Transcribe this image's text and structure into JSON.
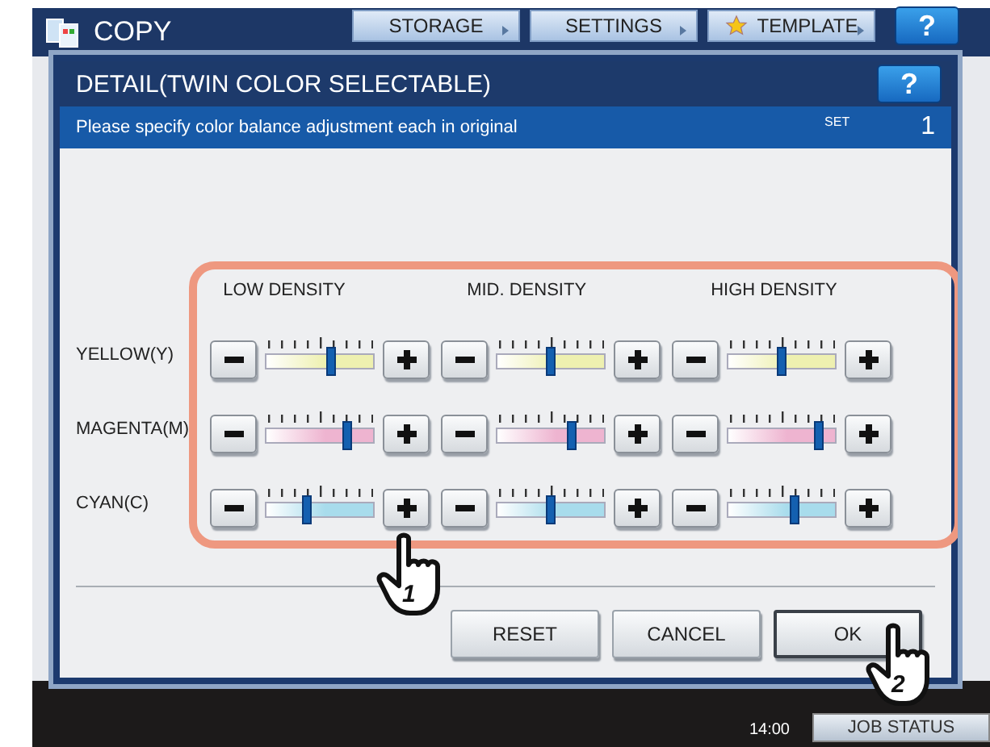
{
  "app": {
    "title": "COPY",
    "tabs": [
      {
        "label": "STORAGE",
        "kind": "plain"
      },
      {
        "label": "SETTINGS",
        "kind": "plain"
      },
      {
        "label": "TEMPLATE",
        "kind": "star"
      }
    ],
    "help": "?"
  },
  "dialog": {
    "title": "DETAIL(TWIN COLOR SELECTABLE)",
    "help": "?",
    "message": "Please specify color balance adjustment each in original",
    "set_label": "SET",
    "set_count": "1",
    "columns": [
      "LOW DENSITY",
      "MID. DENSITY",
      "HIGH DENSITY"
    ],
    "rows": [
      {
        "label": "YELLOW(Y)",
        "color": "#eef0b0",
        "sliders": [
          {
            "level": 0.6
          },
          {
            "level": 0.5
          },
          {
            "level": 0.5
          }
        ]
      },
      {
        "label": "MAGENTA(M)",
        "color": "#eeb4d0",
        "sliders": [
          {
            "level": 0.75
          },
          {
            "level": 0.7
          },
          {
            "level": 0.85
          }
        ]
      },
      {
        "label": "CYAN(C)",
        "color": "#a8dcec",
        "sliders": [
          {
            "level": 0.38
          },
          {
            "level": 0.5
          },
          {
            "level": 0.62
          }
        ]
      }
    ],
    "buttons": [
      {
        "label": "RESET",
        "selected": false
      },
      {
        "label": "CANCEL",
        "selected": false
      },
      {
        "label": "OK",
        "selected": true
      }
    ]
  },
  "footer": {
    "time": "14:00",
    "status_button": "JOB STATUS"
  },
  "callouts": [
    {
      "number": "1"
    },
    {
      "number": "2"
    }
  ]
}
